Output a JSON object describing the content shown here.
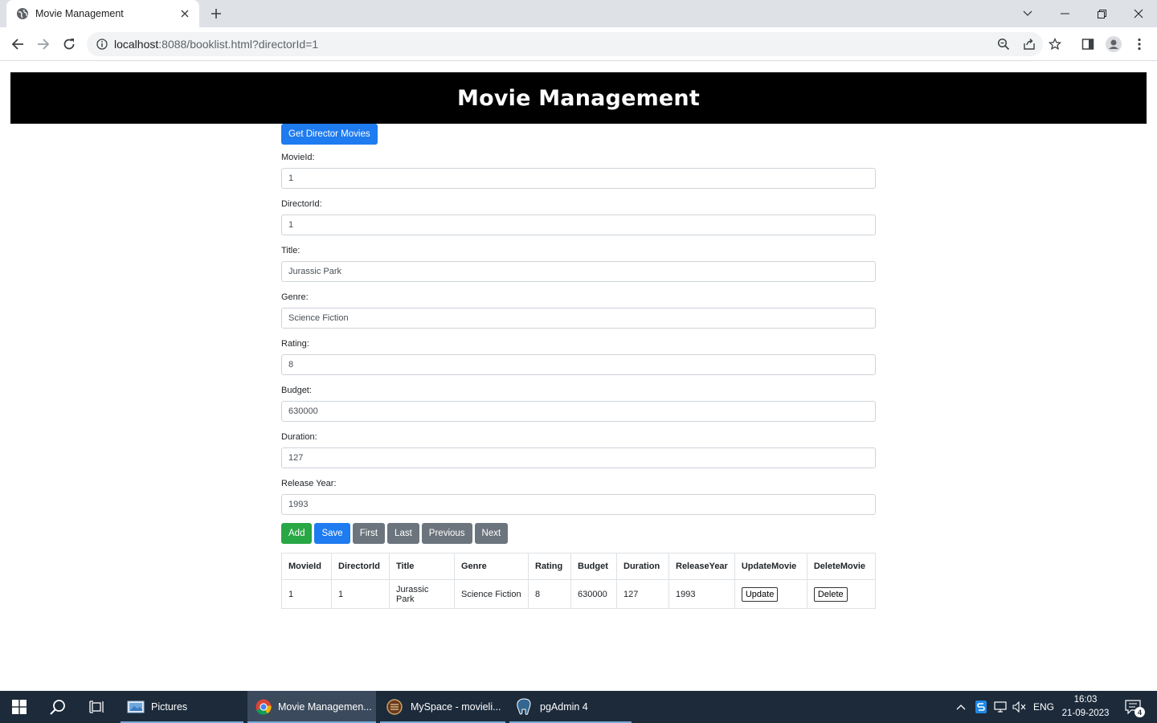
{
  "browser": {
    "tab_title": "Movie Management",
    "url_host": "localhost",
    "url_path": ":8088/booklist.html?directorId=1"
  },
  "page": {
    "title": "Movie Management",
    "get_button": "Get Director Movies"
  },
  "form": {
    "fields": [
      {
        "label": "MovieId:",
        "value": "1"
      },
      {
        "label": "DirectorId:",
        "value": "1"
      },
      {
        "label": "Title:",
        "value": "Jurassic Park"
      },
      {
        "label": "Genre:",
        "value": "Science Fiction"
      },
      {
        "label": "Rating:",
        "value": "8"
      },
      {
        "label": "Budget:",
        "value": "630000"
      },
      {
        "label": "Duration:",
        "value": "127"
      },
      {
        "label": "Release Year:",
        "value": "1993"
      }
    ],
    "buttons": {
      "add": "Add",
      "save": "Save",
      "first": "First",
      "last": "Last",
      "previous": "Previous",
      "next": "Next"
    }
  },
  "table": {
    "headers": [
      "MovieId",
      "DirectorId",
      "Title",
      "Genre",
      "Rating",
      "Budget",
      "Duration",
      "ReleaseYear",
      "UpdateMovie",
      "DeleteMovie"
    ],
    "rows": [
      {
        "cells": [
          "1",
          "1",
          "Jurassic Park",
          "Science Fiction",
          "8",
          "630000",
          "127",
          "1993"
        ],
        "update_label": "Update",
        "delete_label": "Delete"
      }
    ]
  },
  "taskbar": {
    "items": [
      "Pictures",
      "Movie Managemen...",
      "MySpace - movieli...",
      "pgAdmin 4"
    ],
    "language": "ENG",
    "time": "16:03",
    "date": "21-09-2023",
    "notification_count": "4"
  },
  "colors": {
    "primary": "#1e7bf0",
    "success": "#28a745",
    "secondary": "#6c757d",
    "header_bg": "#000000"
  }
}
